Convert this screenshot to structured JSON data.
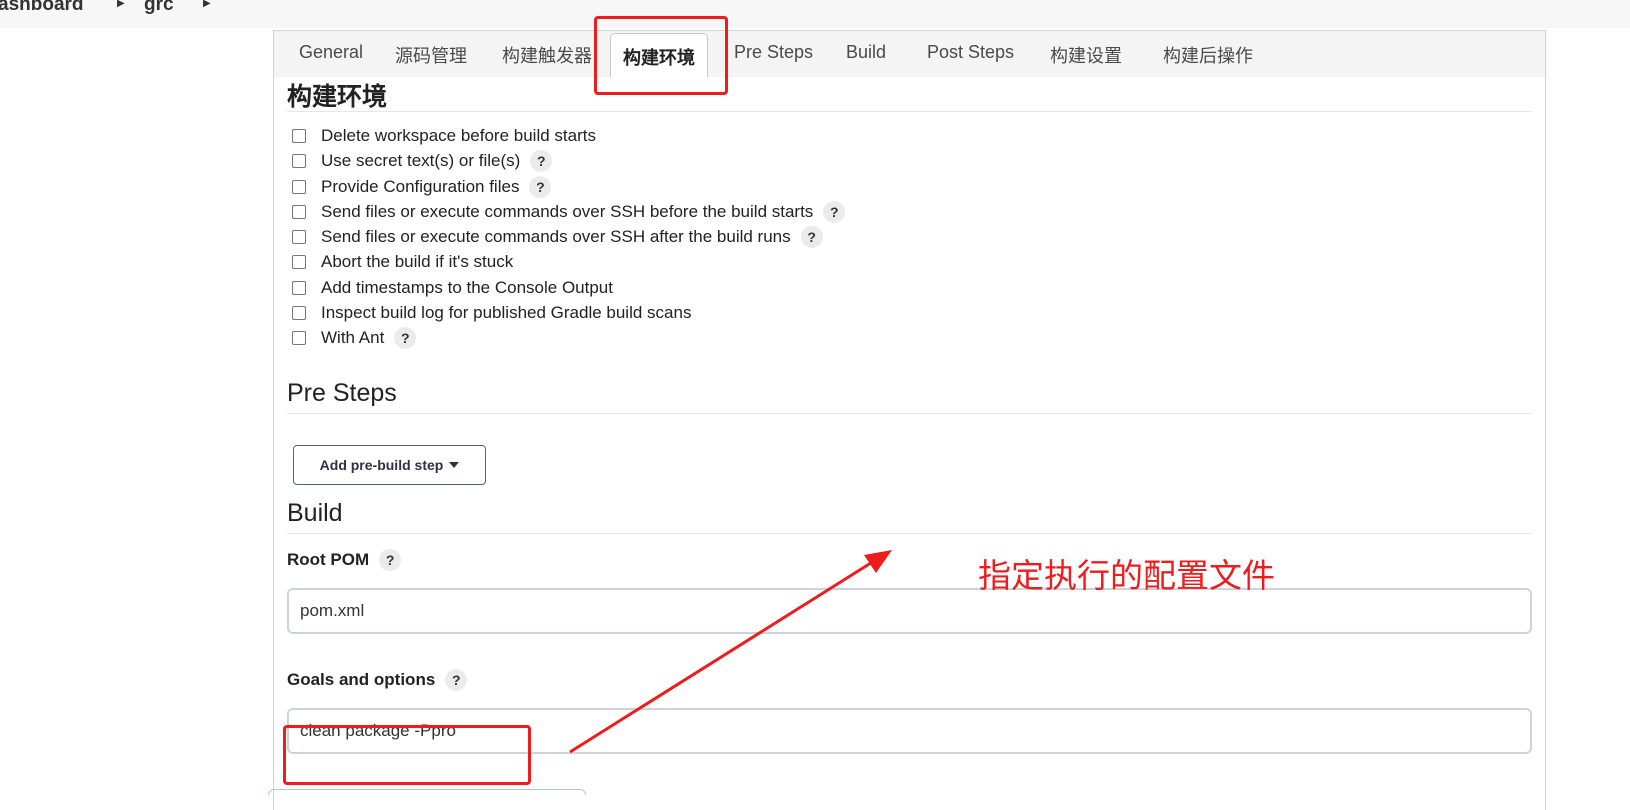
{
  "breadcrumb": {
    "items": [
      "ashboard",
      "grc"
    ]
  },
  "tabs": [
    {
      "label": "General"
    },
    {
      "label": "源码管理"
    },
    {
      "label": "构建触发器"
    },
    {
      "label": "构建环境"
    },
    {
      "label": "Pre Steps"
    },
    {
      "label": "Build"
    },
    {
      "label": "Post Steps"
    },
    {
      "label": "构建设置"
    },
    {
      "label": "构建后操作"
    }
  ],
  "build_env": {
    "title": "构建环境",
    "options": [
      {
        "label": "Delete workspace before build starts",
        "checked": false,
        "help": false
      },
      {
        "label": "Use secret text(s) or file(s)",
        "checked": false,
        "help": true
      },
      {
        "label": "Provide Configuration files",
        "checked": false,
        "help": true
      },
      {
        "label": "Send files or execute commands over SSH before the build starts",
        "checked": false,
        "help": true
      },
      {
        "label": "Send files or execute commands over SSH after the build runs",
        "checked": false,
        "help": true
      },
      {
        "label": "Abort the build if it's stuck",
        "checked": false,
        "help": false
      },
      {
        "label": "Add timestamps to the Console Output",
        "checked": false,
        "help": false
      },
      {
        "label": "Inspect build log for published Gradle build scans",
        "checked": false,
        "help": false
      },
      {
        "label": "With Ant",
        "checked": false,
        "help": true
      }
    ]
  },
  "pre_steps": {
    "title": "Pre Steps",
    "add_button": "Add pre-build step"
  },
  "build": {
    "title": "Build",
    "root_pom_label": "Root POM",
    "root_pom_value": "pom.xml",
    "goals_label": "Goals and options",
    "goals_value": "clean package -Ppro"
  },
  "help_glyph": "?",
  "annotation": {
    "text": "指定执行的配置文件",
    "color": "#ee1c1c"
  }
}
